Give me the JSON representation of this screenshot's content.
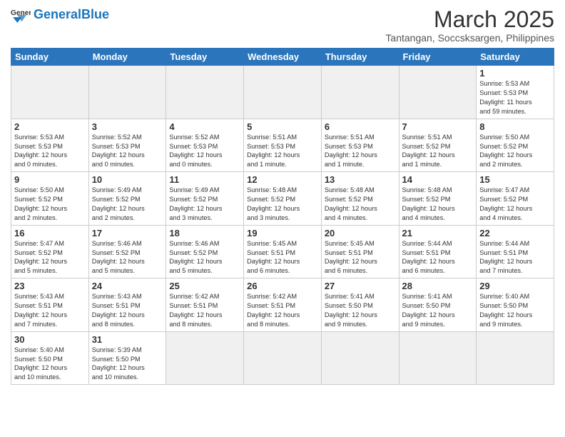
{
  "header": {
    "logo_general": "General",
    "logo_blue": "Blue",
    "title": "March 2025",
    "subtitle": "Tantangan, Soccsksargen, Philippines"
  },
  "days_of_week": [
    "Sunday",
    "Monday",
    "Tuesday",
    "Wednesday",
    "Thursday",
    "Friday",
    "Saturday"
  ],
  "weeks": [
    [
      {
        "day": "",
        "info": ""
      },
      {
        "day": "",
        "info": ""
      },
      {
        "day": "",
        "info": ""
      },
      {
        "day": "",
        "info": ""
      },
      {
        "day": "",
        "info": ""
      },
      {
        "day": "",
        "info": ""
      },
      {
        "day": "1",
        "info": "Sunrise: 5:53 AM\nSunset: 5:53 PM\nDaylight: 11 hours\nand 59 minutes."
      }
    ],
    [
      {
        "day": "2",
        "info": "Sunrise: 5:53 AM\nSunset: 5:53 PM\nDaylight: 12 hours\nand 0 minutes."
      },
      {
        "day": "3",
        "info": "Sunrise: 5:52 AM\nSunset: 5:53 PM\nDaylight: 12 hours\nand 0 minutes."
      },
      {
        "day": "4",
        "info": "Sunrise: 5:52 AM\nSunset: 5:53 PM\nDaylight: 12 hours\nand 0 minutes."
      },
      {
        "day": "5",
        "info": "Sunrise: 5:51 AM\nSunset: 5:53 PM\nDaylight: 12 hours\nand 1 minute."
      },
      {
        "day": "6",
        "info": "Sunrise: 5:51 AM\nSunset: 5:53 PM\nDaylight: 12 hours\nand 1 minute."
      },
      {
        "day": "7",
        "info": "Sunrise: 5:51 AM\nSunset: 5:52 PM\nDaylight: 12 hours\nand 1 minute."
      },
      {
        "day": "8",
        "info": "Sunrise: 5:50 AM\nSunset: 5:52 PM\nDaylight: 12 hours\nand 2 minutes."
      }
    ],
    [
      {
        "day": "9",
        "info": "Sunrise: 5:50 AM\nSunset: 5:52 PM\nDaylight: 12 hours\nand 2 minutes."
      },
      {
        "day": "10",
        "info": "Sunrise: 5:49 AM\nSunset: 5:52 PM\nDaylight: 12 hours\nand 2 minutes."
      },
      {
        "day": "11",
        "info": "Sunrise: 5:49 AM\nSunset: 5:52 PM\nDaylight: 12 hours\nand 3 minutes."
      },
      {
        "day": "12",
        "info": "Sunrise: 5:48 AM\nSunset: 5:52 PM\nDaylight: 12 hours\nand 3 minutes."
      },
      {
        "day": "13",
        "info": "Sunrise: 5:48 AM\nSunset: 5:52 PM\nDaylight: 12 hours\nand 4 minutes."
      },
      {
        "day": "14",
        "info": "Sunrise: 5:48 AM\nSunset: 5:52 PM\nDaylight: 12 hours\nand 4 minutes."
      },
      {
        "day": "15",
        "info": "Sunrise: 5:47 AM\nSunset: 5:52 PM\nDaylight: 12 hours\nand 4 minutes."
      }
    ],
    [
      {
        "day": "16",
        "info": "Sunrise: 5:47 AM\nSunset: 5:52 PM\nDaylight: 12 hours\nand 5 minutes."
      },
      {
        "day": "17",
        "info": "Sunrise: 5:46 AM\nSunset: 5:52 PM\nDaylight: 12 hours\nand 5 minutes."
      },
      {
        "day": "18",
        "info": "Sunrise: 5:46 AM\nSunset: 5:52 PM\nDaylight: 12 hours\nand 5 minutes."
      },
      {
        "day": "19",
        "info": "Sunrise: 5:45 AM\nSunset: 5:51 PM\nDaylight: 12 hours\nand 6 minutes."
      },
      {
        "day": "20",
        "info": "Sunrise: 5:45 AM\nSunset: 5:51 PM\nDaylight: 12 hours\nand 6 minutes."
      },
      {
        "day": "21",
        "info": "Sunrise: 5:44 AM\nSunset: 5:51 PM\nDaylight: 12 hours\nand 6 minutes."
      },
      {
        "day": "22",
        "info": "Sunrise: 5:44 AM\nSunset: 5:51 PM\nDaylight: 12 hours\nand 7 minutes."
      }
    ],
    [
      {
        "day": "23",
        "info": "Sunrise: 5:43 AM\nSunset: 5:51 PM\nDaylight: 12 hours\nand 7 minutes."
      },
      {
        "day": "24",
        "info": "Sunrise: 5:43 AM\nSunset: 5:51 PM\nDaylight: 12 hours\nand 8 minutes."
      },
      {
        "day": "25",
        "info": "Sunrise: 5:42 AM\nSunset: 5:51 PM\nDaylight: 12 hours\nand 8 minutes."
      },
      {
        "day": "26",
        "info": "Sunrise: 5:42 AM\nSunset: 5:51 PM\nDaylight: 12 hours\nand 8 minutes."
      },
      {
        "day": "27",
        "info": "Sunrise: 5:41 AM\nSunset: 5:50 PM\nDaylight: 12 hours\nand 9 minutes."
      },
      {
        "day": "28",
        "info": "Sunrise: 5:41 AM\nSunset: 5:50 PM\nDaylight: 12 hours\nand 9 minutes."
      },
      {
        "day": "29",
        "info": "Sunrise: 5:40 AM\nSunset: 5:50 PM\nDaylight: 12 hours\nand 9 minutes."
      }
    ],
    [
      {
        "day": "30",
        "info": "Sunrise: 5:40 AM\nSunset: 5:50 PM\nDaylight: 12 hours\nand 10 minutes."
      },
      {
        "day": "31",
        "info": "Sunrise: 5:39 AM\nSunset: 5:50 PM\nDaylight: 12 hours\nand 10 minutes."
      },
      {
        "day": "",
        "info": ""
      },
      {
        "day": "",
        "info": ""
      },
      {
        "day": "",
        "info": ""
      },
      {
        "day": "",
        "info": ""
      },
      {
        "day": "",
        "info": ""
      }
    ]
  ]
}
